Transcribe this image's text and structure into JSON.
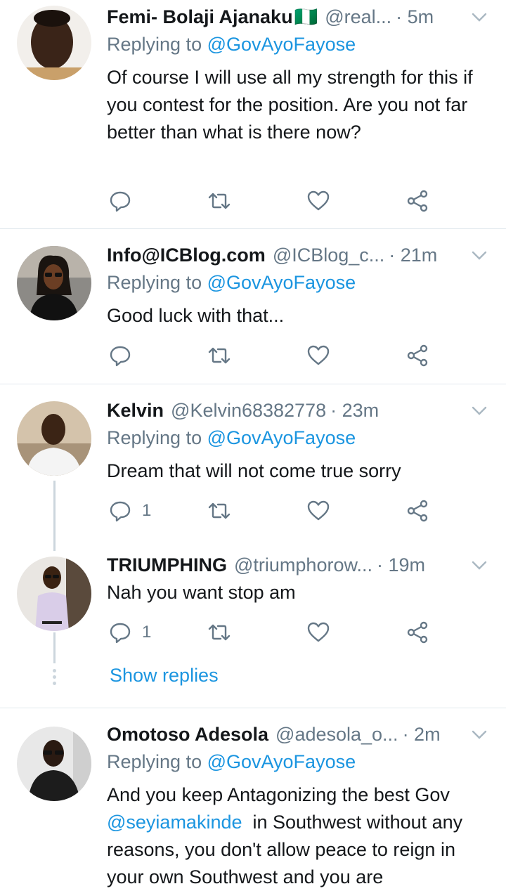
{
  "tweets": [
    {
      "name": "Femi- Bolaji Ajanaku",
      "flag": "🇳🇬",
      "handle": "@real...",
      "time": "· 5m",
      "replying_prefix": "Replying to ",
      "replying_to": "@GovAyoFayose",
      "text": "Of course I will use all my strength for this if you contest for the position. Are you not far better than what is there now?"
    },
    {
      "name": "Info@ICBlog.com",
      "handle": "@ICBlog_c...",
      "time": "· 21m",
      "replying_prefix": "Replying to ",
      "replying_to": "@GovAyoFayose",
      "text": "Good luck with that..."
    },
    {
      "name": "Kelvin",
      "handle": "@Kelvin68382778",
      "time": "· 23m",
      "replying_prefix": "Replying to ",
      "replying_to": "@GovAyoFayose",
      "text": "Dream that will not come true sorry",
      "reply_count": "1"
    },
    {
      "name": "TRIUMPHING",
      "handle": "@triumphorow...",
      "time": "· 19m",
      "text": "Nah you want stop am",
      "reply_count": "1"
    },
    {
      "name": "Omotoso Adesola",
      "handle": "@adesola_o...",
      "time": "· 2m",
      "replying_prefix": "Replying to ",
      "replying_to": "@GovAyoFayose",
      "text_prefix": "And you keep Antagonizing the best Gov ",
      "text_mention": "@seyiamakinde",
      "text_suffix": "  in Southwest without any reasons, you don't allow peace to reign in your own Southwest and you are"
    }
  ],
  "show_replies": "Show replies",
  "colors": {
    "accent": "#1b95e0",
    "muted": "#657786",
    "divider": "#e1e8ed",
    "thread": "#ccd6dd"
  },
  "icons": [
    "reply-icon",
    "retweet-icon",
    "like-icon",
    "share-icon",
    "chevron-down-icon"
  ]
}
